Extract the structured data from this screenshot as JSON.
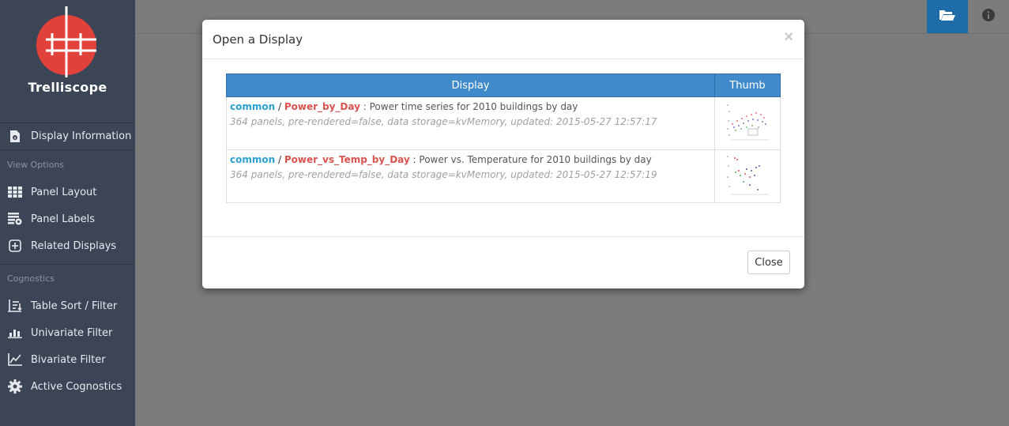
{
  "app": {
    "name": "Trelliscope",
    "brand_color": "#e0413a"
  },
  "sidebar": {
    "display_info_label": "Display Information",
    "view_options_heading": "View Options",
    "view_options": [
      {
        "label": "Panel Layout",
        "icon": "grid-icon"
      },
      {
        "label": "Panel Labels",
        "icon": "labels-gear-icon"
      },
      {
        "label": "Related Displays",
        "icon": "plus-square-icon"
      }
    ],
    "cognostics_heading": "Cognostics",
    "cognostics": [
      {
        "label": "Table Sort / Filter",
        "icon": "table-sort-icon"
      },
      {
        "label": "Univariate Filter",
        "icon": "bar-chart-icon"
      },
      {
        "label": "Bivariate Filter",
        "icon": "line-chart-icon"
      },
      {
        "label": "Active Cognostics",
        "icon": "gear-icon"
      }
    ]
  },
  "topbar": {
    "open_icon": "folder-open-icon",
    "info_icon": "info-icon",
    "active_color": "#1e6ca8"
  },
  "modal": {
    "title": "Open a Display",
    "close_label": "Close",
    "table": {
      "headers": [
        "Display",
        "Thumb"
      ],
      "rows": [
        {
          "group": "common",
          "name": "Power_by_Day",
          "description": " : Power time series for 2010 buildings by day",
          "meta": "364 panels, pre-rendered=false, data storage=kvMemory, updated: 2015-05-27 12:57:17"
        },
        {
          "group": "common",
          "name": "Power_vs_Temp_by_Day",
          "description": " : Power vs. Temperature for 2010 buildings by day",
          "meta": "364 panels, pre-rendered=false, data storage=kvMemory, updated: 2015-05-27 12:57:19"
        }
      ]
    }
  }
}
